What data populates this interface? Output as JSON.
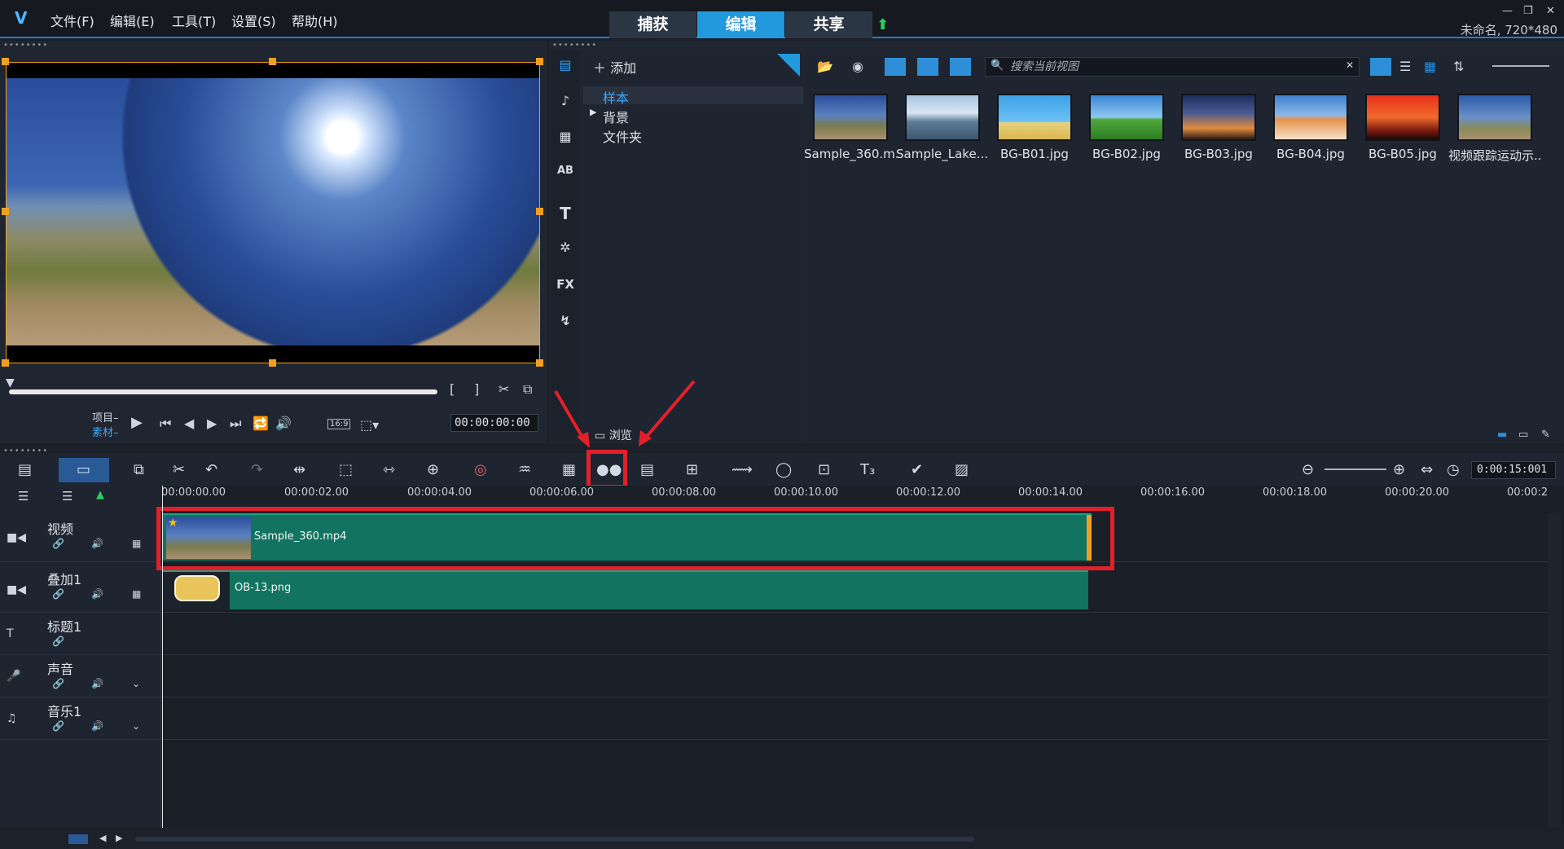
{
  "menu": {
    "file": "文件(F)",
    "edit": "编辑(E)",
    "tools": "工具(T)",
    "settings": "设置(S)",
    "help": "帮助(H)"
  },
  "mode_tabs": {
    "capture": "捕获",
    "edit": "编辑",
    "share": "共享"
  },
  "project_info": "未命名, 720*480",
  "preview": {
    "mode_project": "项目–",
    "mode_clip": "素材–",
    "aspect": "16:9",
    "timecode": "00:00:00:00"
  },
  "library": {
    "add_label": "添加",
    "tree": [
      "样本",
      "背景",
      "文件夹"
    ],
    "search_placeholder": "搜索当前视图",
    "browse_label": "浏览",
    "thumbnails": [
      "Sample_360.m...",
      "Sample_Lake....",
      "BG-B01.jpg",
      "BG-B02.jpg",
      "BG-B03.jpg",
      "BG-B04.jpg",
      "BG-B05.jpg",
      "视频跟踪运动示..."
    ]
  },
  "timeline": {
    "duration": "0:00:15:001",
    "ruler": [
      "00:00:00.00",
      "00:00:02.00",
      "00:00:04.00",
      "00:00:06.00",
      "00:00:08.00",
      "00:00:10.00",
      "00:00:12.00",
      "00:00:14.00",
      "00:00:16.00",
      "00:00:18.00",
      "00:00:20.00",
      "00:00:2"
    ],
    "tracks": [
      "视频",
      "叠加1",
      "标题1",
      "声音",
      "音乐1"
    ],
    "clips": {
      "video": "Sample_360.mp4",
      "overlay": "OB-13.png"
    }
  },
  "colors": {
    "accent": "#2199dc",
    "highlight": "#e3202a",
    "clip": "#127460"
  }
}
